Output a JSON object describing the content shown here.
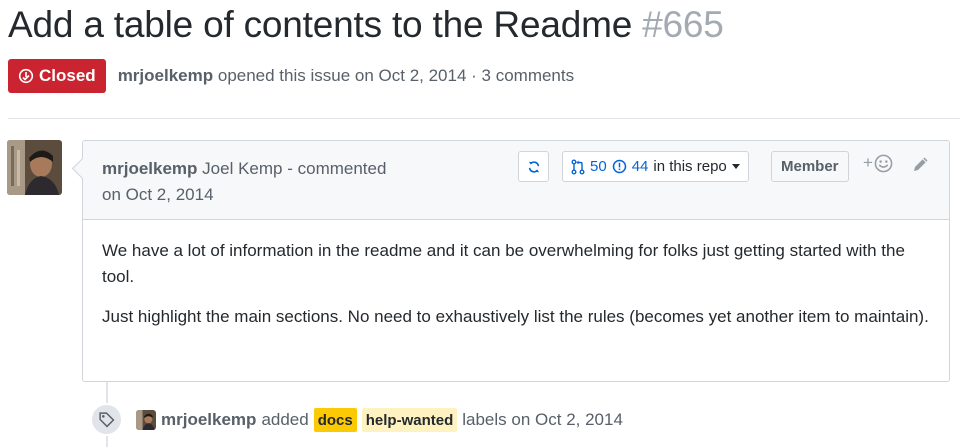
{
  "issue": {
    "title": "Add a table of contents to the Readme",
    "number": "#665",
    "state": "Closed",
    "author": "mrjoelkemp",
    "opened_text": "opened this issue on Oct 2, 2014 · 3 comments"
  },
  "comment": {
    "author": "mrjoelkemp",
    "author_fullname": "Joel Kemp",
    "action": "- commented",
    "date": "on Oct 2, 2014",
    "pr_count": "50",
    "issue_count": "44",
    "scope_label": "in this repo",
    "role": "Member",
    "react_prefix": "+",
    "paragraphs": [
      "We have a lot of information in the readme and it can be overwhelming for folks just getting started with the tool.",
      "Just highlight the main sections. No need to exhaustively list the rules (becomes yet another item to maintain)."
    ]
  },
  "event": {
    "author": "mrjoelkemp",
    "action": "added",
    "labels": [
      {
        "name": "docs",
        "color": "#fbca04"
      },
      {
        "name": "help-wanted",
        "color": "#fef2c0"
      }
    ],
    "suffix": "labels on Oct 2, 2014"
  },
  "icons": {
    "state": "issue-closed-icon",
    "refresh": "sync-icon",
    "pr": "git-pull-request-icon",
    "issue": "issue-opened-icon",
    "react": "smiley-icon",
    "edit": "pencil-icon",
    "event": "tag-icon"
  },
  "colors": {
    "closed": "#cb2431",
    "link": "#0366d6",
    "muted": "#586069"
  }
}
